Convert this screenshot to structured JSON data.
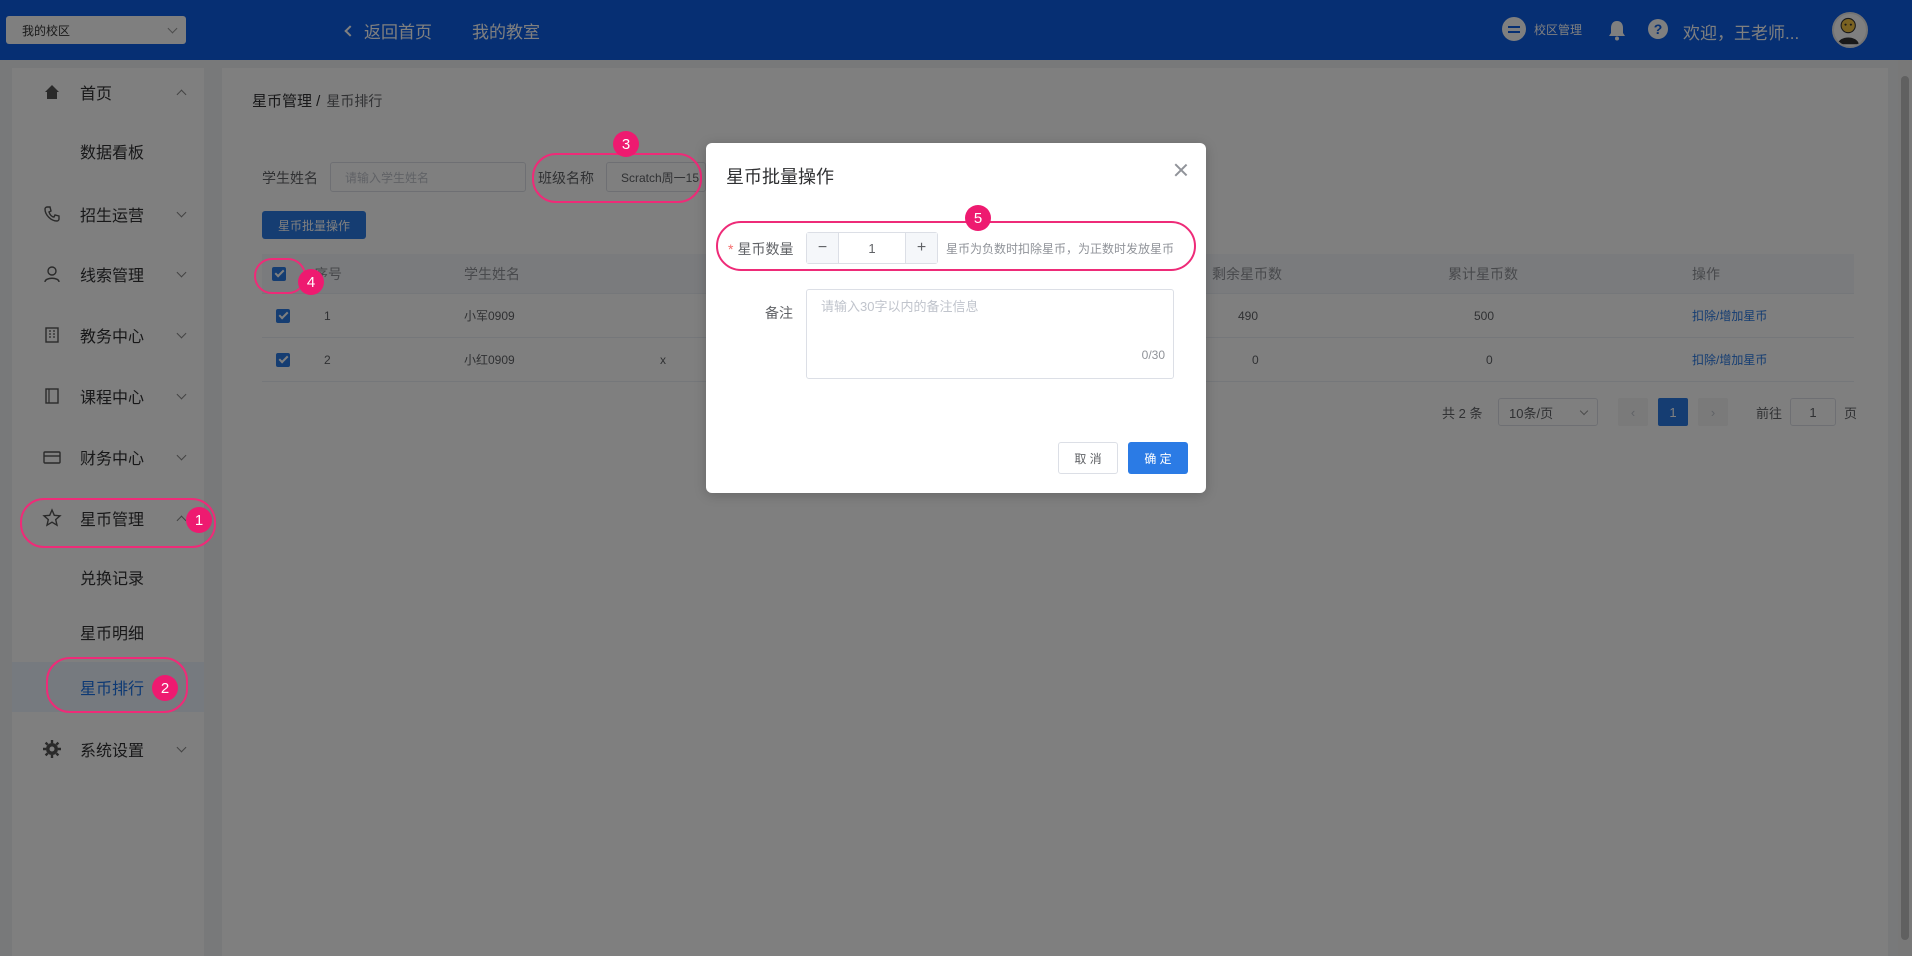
{
  "topbar": {
    "campus_select": "我的校区",
    "back_home": "返回首页",
    "my_class": "我的教室",
    "campus_manage": "校区管理",
    "welcome": "欢迎，王老师..."
  },
  "sidebar": {
    "home": "首页",
    "dashboard": "数据看板",
    "recruit": "招生运营",
    "leads": "线索管理",
    "academic": "教务中心",
    "course": "课程中心",
    "finance": "财务中心",
    "star_mgmt": "星币管理",
    "exchange_records": "兑换记录",
    "star_detail": "星币明细",
    "star_rank": "星币排行",
    "settings": "系统设置"
  },
  "breadcrumb": {
    "parent": "星币管理 /",
    "current": "星币排行"
  },
  "filters": {
    "student_label": "学生姓名",
    "student_placeholder": "请输入学生姓名",
    "class_label": "班级名称",
    "class_value": "Scratch周一15"
  },
  "batch_button": "星币批量操作",
  "table": {
    "headers": [
      "序号",
      "学生姓名",
      "剩余星币数",
      "累计星币数",
      "操作"
    ],
    "rows": [
      {
        "no": "1",
        "name": "小军0909",
        "mid": "",
        "remain": "490",
        "total": "500",
        "action": "扣除/增加星币"
      },
      {
        "no": "2",
        "name": "小红0909",
        "mid": "x",
        "remain": "0",
        "total": "0",
        "action": "扣除/增加星币"
      }
    ]
  },
  "pager": {
    "total": "共 2 条",
    "size": "10条/页",
    "page": "1",
    "goto": "前往",
    "goto_page": "1",
    "page_unit": "页"
  },
  "dialog": {
    "title": "星币批量操作",
    "count_label": "星币数量",
    "count_value": "1",
    "count_hint": "星币为负数时扣除星币，为正数时发放星币",
    "remark_label": "备注",
    "remark_placeholder": "请输入30字以内的备注信息",
    "counter": "0/30",
    "cancel": "取 消",
    "ok": "确 定"
  },
  "badges": [
    "1",
    "2",
    "3",
    "4",
    "5"
  ],
  "colors": {
    "topbar": "#0d5ee6",
    "primary": "#2b7be5",
    "annotation": "#ee1a70"
  }
}
